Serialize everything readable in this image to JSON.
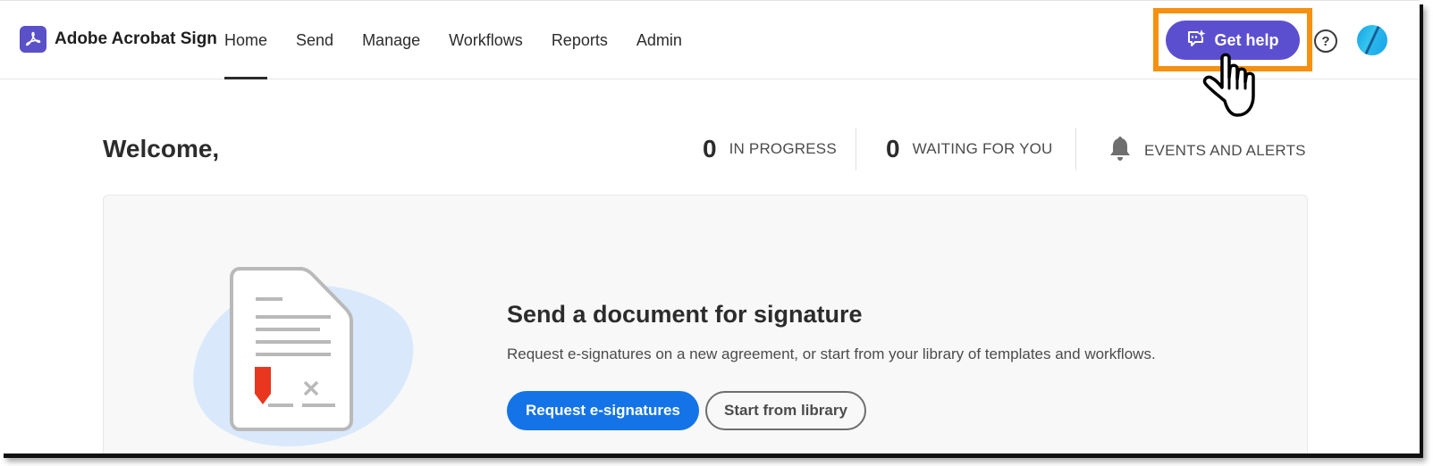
{
  "header": {
    "brand_name": "Adobe Acrobat Sign",
    "brand_icon": "acrobat-logo-icon",
    "nav": [
      {
        "label": "Home",
        "active": true
      },
      {
        "label": "Send",
        "active": false
      },
      {
        "label": "Manage",
        "active": false
      },
      {
        "label": "Workflows",
        "active": false
      },
      {
        "label": "Reports",
        "active": false
      },
      {
        "label": "Admin",
        "active": false
      }
    ],
    "get_help_label": "Get help",
    "get_help_icon": "chat-sparkle-icon",
    "help_icon_glyph": "?",
    "help_icon": "help-circle-icon",
    "avatar_icon": "user-avatar"
  },
  "dashboard": {
    "welcome": "Welcome,",
    "stats": [
      {
        "count": "0",
        "label": "IN PROGRESS"
      },
      {
        "count": "0",
        "label": "WAITING FOR YOU"
      },
      {
        "icon": "bell-icon",
        "label": "EVENTS AND ALERTS"
      }
    ]
  },
  "card": {
    "title": "Send a document for signature",
    "description": "Request e-signatures on a new agreement, or start from your library of templates and workflows.",
    "primary_button": "Request e-signatures",
    "secondary_button": "Start from library",
    "illustration_icon": "document-signature-icon"
  },
  "colors": {
    "brand": "#5a50c8",
    "get_help_bg": "#5b4fd0",
    "highlight": "#f6900e",
    "primary_button": "#1473e6",
    "signature_marker": "#e8361f"
  }
}
